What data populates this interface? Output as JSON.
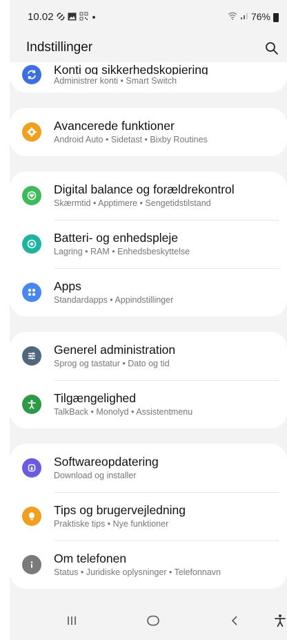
{
  "status_bar": {
    "time": "10.02",
    "battery": "76%",
    "icons_left": [
      "link-icon",
      "image-icon",
      "qr-icon",
      "dot-icon"
    ],
    "icons_right": [
      "wifi-icon",
      "signal-icon",
      "battery-icon"
    ]
  },
  "header": {
    "title": "Indstillinger"
  },
  "groups": [
    {
      "items": [
        {
          "title": "Konti og sikkerhedskopiering",
          "subtitle": "Administrer konti • Smart Switch",
          "icon": "sync-icon",
          "color": "#3d6fe0"
        }
      ]
    },
    {
      "items": [
        {
          "title": "Avancerede funktioner",
          "subtitle": "Android Auto • Sidetast • Bixby Routines",
          "icon": "gear-plus-icon",
          "color": "#f0a020"
        }
      ]
    },
    {
      "items": [
        {
          "title": "Digital balance og forældrekontrol",
          "subtitle": "Skærmtid • Apptimere • Sengetidstilstand",
          "icon": "heart-circle-icon",
          "color": "#3fba5a"
        },
        {
          "title": "Batteri- og enhedspleje",
          "subtitle": "Lagring • RAM • Enhedsbeskyttelse",
          "icon": "device-care-icon",
          "color": "#20b3a0"
        },
        {
          "title": "Apps",
          "subtitle": "Standardapps • Appindstillinger",
          "icon": "apps-grid-icon",
          "color": "#4a86f0"
        }
      ]
    },
    {
      "items": [
        {
          "title": "Generel administration",
          "subtitle": "Sprog og tastatur • Dato og tid",
          "icon": "sliders-icon",
          "color": "#50677e"
        },
        {
          "title": "Tilgængelighed",
          "subtitle": "TalkBack • Monolyd • Assistentmenu",
          "icon": "accessibility-icon",
          "color": "#2e9a48"
        }
      ]
    },
    {
      "items": [
        {
          "title": "Softwareopdatering",
          "subtitle": "Download og installer",
          "icon": "update-icon",
          "color": "#6a5be0"
        },
        {
          "title": "Tips og brugervejledning",
          "subtitle": "Praktiske tips • Nye funktioner",
          "icon": "lightbulb-icon",
          "color": "#f0a020"
        },
        {
          "title": "Om telefonen",
          "subtitle": "Status • Juridiske oplysninger • Telefonnavn",
          "icon": "info-icon",
          "color": "#7a7a7a"
        }
      ]
    }
  ],
  "nav_bar": {
    "buttons": [
      "recent-apps-icon",
      "home-icon",
      "back-icon",
      "accessibility-shortcut-icon"
    ]
  }
}
